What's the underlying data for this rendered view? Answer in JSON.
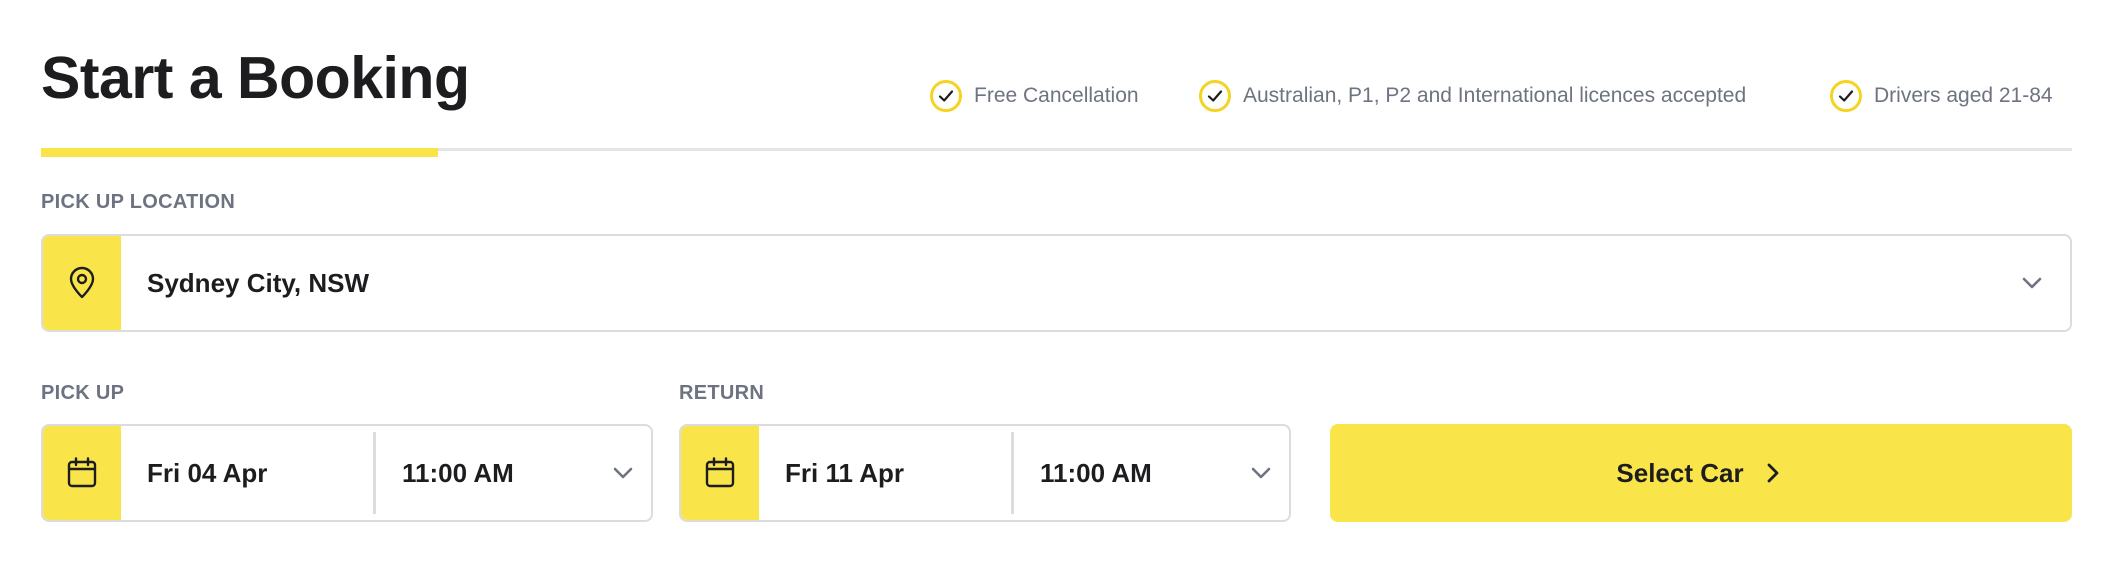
{
  "header": {
    "title": "Start a Booking",
    "features": [
      {
        "icon": "check-icon",
        "label": "Free Cancellation"
      },
      {
        "icon": "check-icon",
        "label": "Australian, P1, P2 and International licences accepted"
      },
      {
        "icon": "check-icon",
        "label": "Drivers aged 21-84"
      }
    ]
  },
  "pickup_location": {
    "label": "PICK UP LOCATION",
    "icon": "map-pin-icon",
    "value": "Sydney City, NSW"
  },
  "pickup": {
    "label": "PICK UP",
    "icon": "calendar-icon",
    "date": "Fri 04 Apr",
    "time": "11:00 AM"
  },
  "return": {
    "label": "RETURN",
    "icon": "calendar-icon",
    "date": "Fri 11 Apr",
    "time": "11:00 AM"
  },
  "cta": {
    "label": "Select Car",
    "icon": "chevron-right-icon"
  },
  "colors": {
    "accent": "#f9e54a",
    "check_ring": "#f5d320",
    "label_grey": "#6d7380",
    "text": "#1d1d1f",
    "border": "#dcdcdc"
  }
}
